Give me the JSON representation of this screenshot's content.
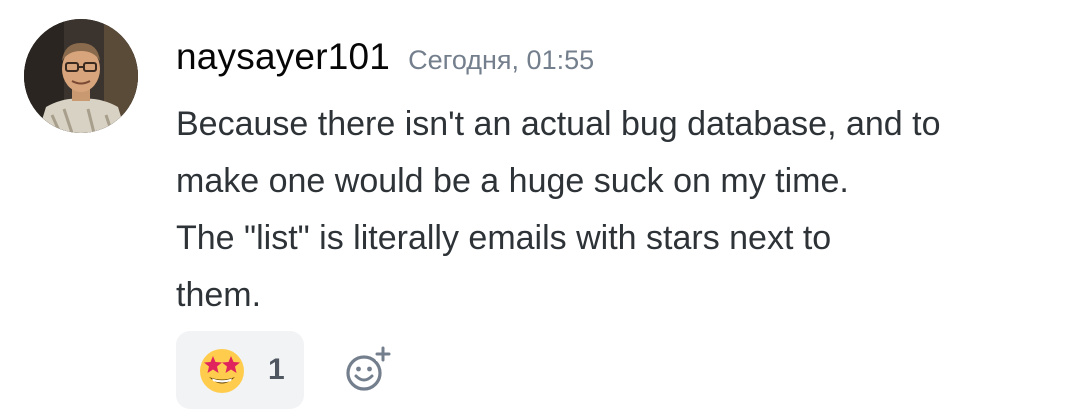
{
  "message": {
    "author": "naysayer101",
    "timestamp": "Сегодня, 01:55",
    "content_lines": [
      "Because there isn't an actual bug database, and to",
      "make one would be a huge suck on my time.",
      "The \"list\" is literally emails with stars next to",
      "them."
    ]
  },
  "reactions": [
    {
      "emoji_icon": "star-struck-emoji-icon",
      "count": "1"
    }
  ],
  "add_reaction_icon": "add-reaction-icon",
  "colors": {
    "username": "#060607",
    "timestamp": "#747f8d",
    "text": "#2e3338",
    "reaction_bg": "#f2f3f5"
  }
}
